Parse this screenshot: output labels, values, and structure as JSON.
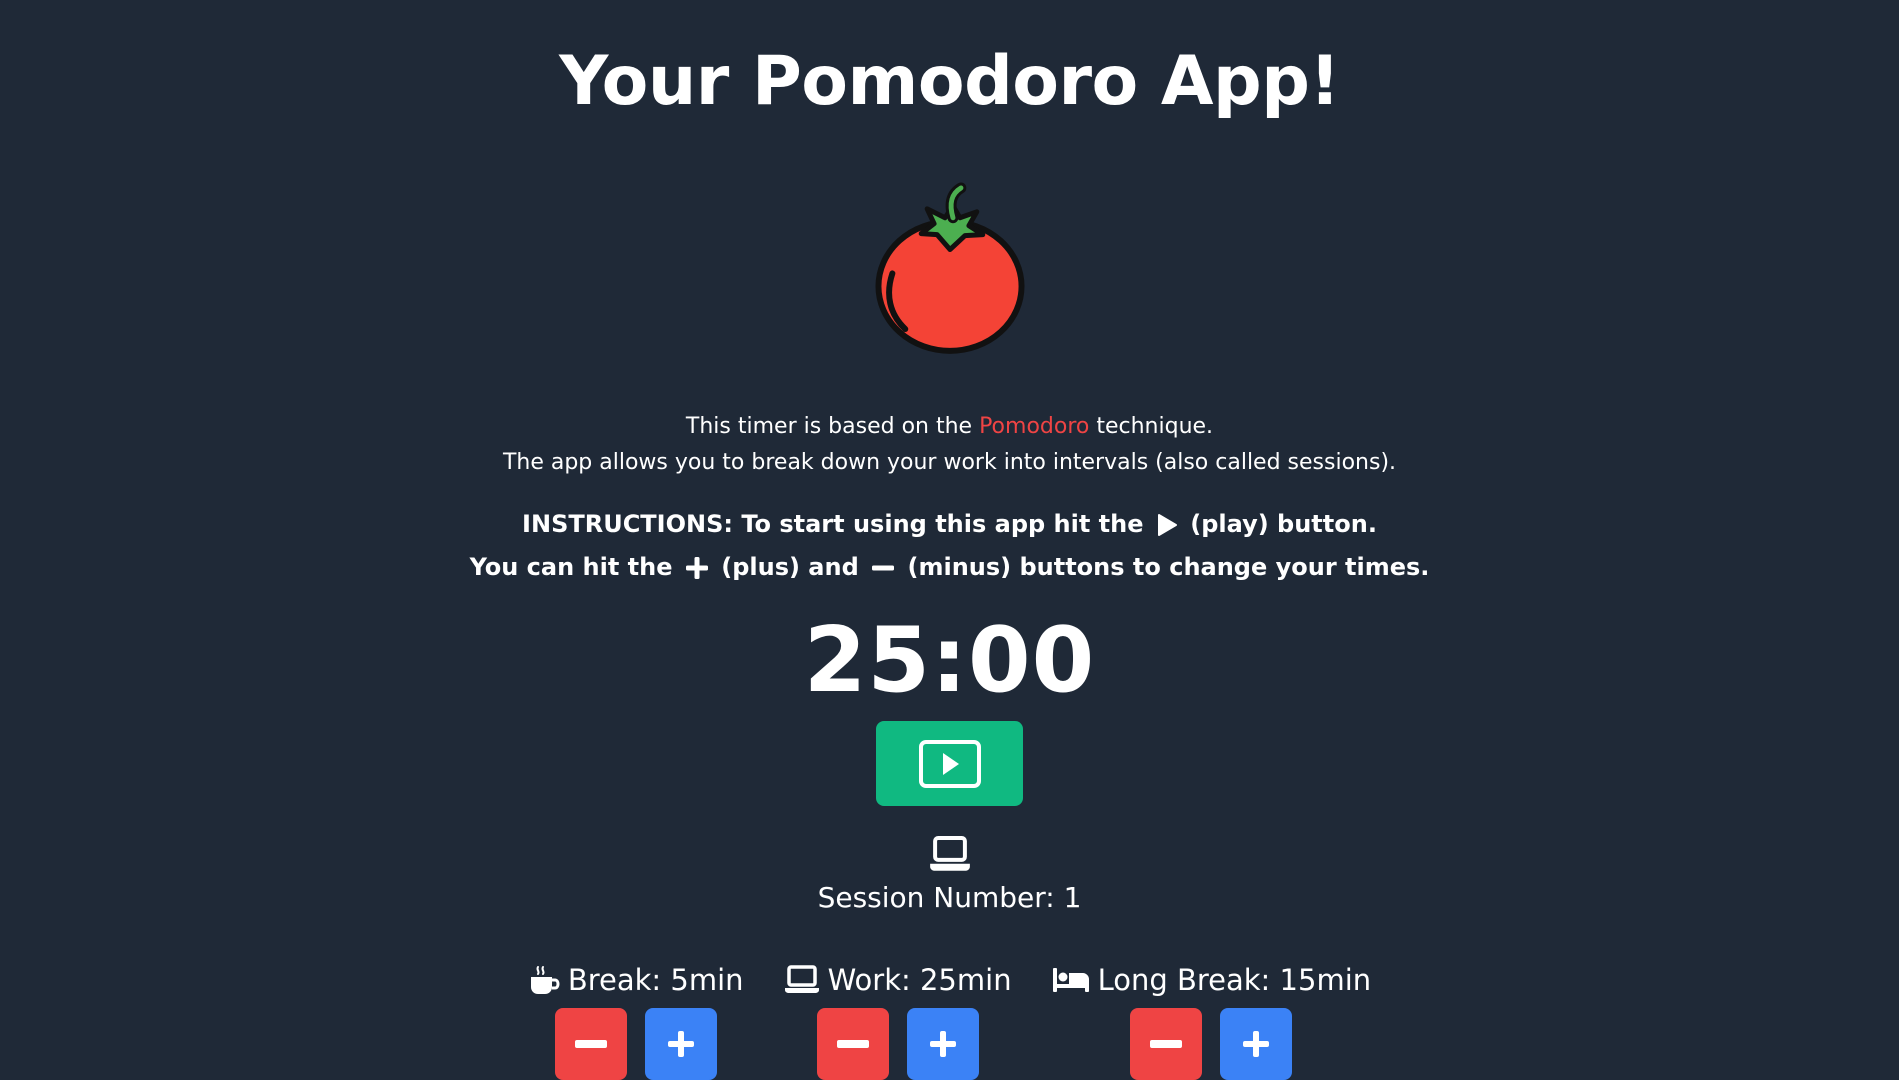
{
  "app": {
    "title": "Your Pomodoro App!"
  },
  "intro": {
    "line1_prefix": "This timer is based on the ",
    "line1_link": "Pomodoro",
    "line1_suffix": " technique.",
    "line2": "The app allows you to break down your work into intervals (also called sessions)."
  },
  "instructions": {
    "line1_prefix": "INSTRUCTIONS: To start using this app hit the",
    "line1_suffix": "(play) button.",
    "line2_prefix": "You can hit the",
    "line2_mid": "(plus) and",
    "line2_suffix": "(minus) buttons to change your times."
  },
  "timer": {
    "display": "25:00"
  },
  "session": {
    "label": "Session Number: 1"
  },
  "settings": {
    "break": {
      "label": "Break: 5min",
      "icon": "coffee-icon"
    },
    "work": {
      "label": "Work: 25min",
      "icon": "laptop-icon"
    },
    "long_break": {
      "label": "Long Break: 15min",
      "icon": "bed-icon"
    }
  },
  "colors": {
    "background": "#1f2937",
    "accent": "#ef4444",
    "play": "#10b981",
    "minus": "#ef4444",
    "plus": "#3b82f6"
  }
}
